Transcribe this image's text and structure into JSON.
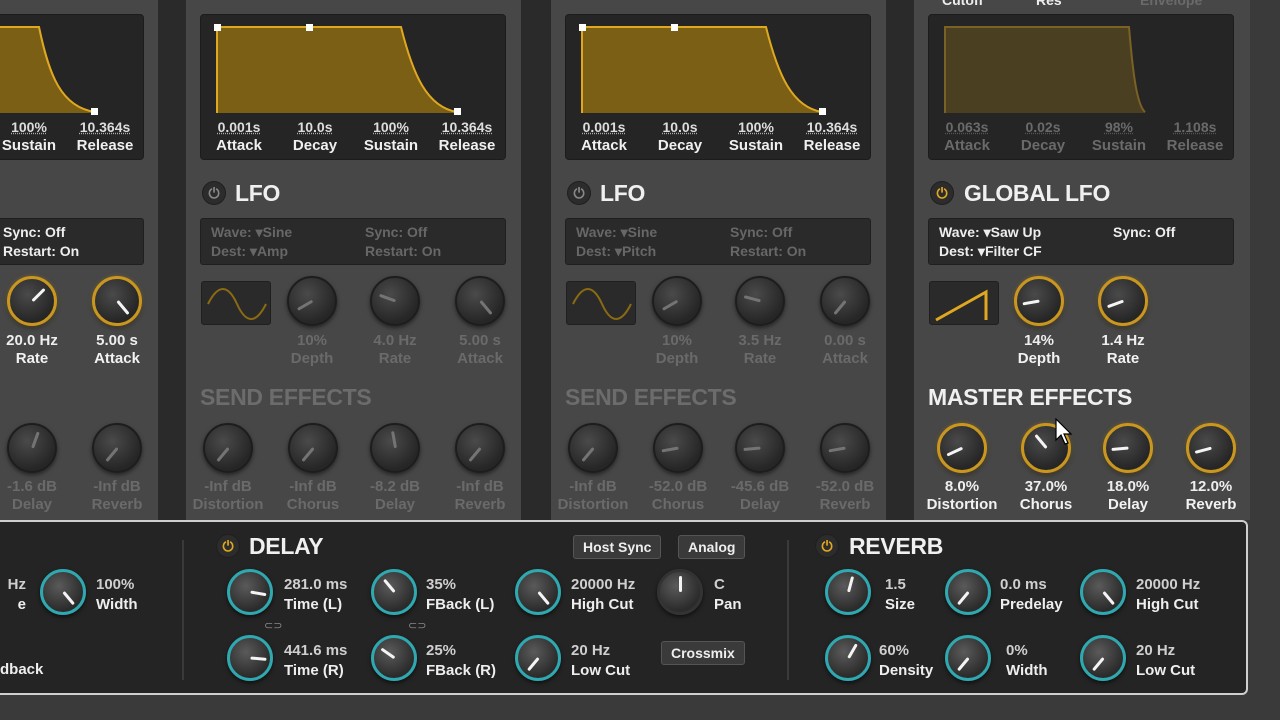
{
  "colors": {
    "accent_gold": "#d9a21f",
    "accent_teal": "#2fa8b0",
    "dim_text": "#6a6a6a"
  },
  "col0": {
    "env": [
      {
        "value": "100%",
        "label": "Sustain"
      },
      {
        "value": "10.364s",
        "label": "Release"
      }
    ],
    "lfo": {
      "sync_label": "Sync:",
      "sync_value": "Off",
      "restart_label": "Restart:",
      "restart_value": "On"
    },
    "knobs": [
      {
        "value": "20.0 Hz",
        "label": "Rate"
      },
      {
        "value": "5.00 s",
        "label": "Attack"
      }
    ],
    "send": [
      {
        "value": "-1.6 dB",
        "label": "Delay"
      },
      {
        "value": "-Inf dB",
        "label": "Reverb"
      }
    ]
  },
  "col1": {
    "env": [
      {
        "value": "0.001s",
        "label": "Attack"
      },
      {
        "value": "10.0s",
        "label": "Decay"
      },
      {
        "value": "100%",
        "label": "Sustain"
      },
      {
        "value": "10.364s",
        "label": "Release"
      }
    ],
    "lfo_title": "LFO",
    "lfo": {
      "wave_label": "Wave:",
      "wave_value": "Sine",
      "dest_label": "Dest:",
      "dest_value": "Amp",
      "sync_label": "Sync:",
      "sync_value": "Off",
      "restart_label": "Restart:",
      "restart_value": "On"
    },
    "knobs": [
      {
        "value": "10%",
        "label": "Depth"
      },
      {
        "value": "4.0 Hz",
        "label": "Rate"
      },
      {
        "value": "5.00 s",
        "label": "Attack"
      }
    ],
    "send_title": "SEND EFFECTS",
    "send": [
      {
        "value": "-Inf dB",
        "label": "Distortion"
      },
      {
        "value": "-Inf dB",
        "label": "Chorus"
      },
      {
        "value": "-8.2 dB",
        "label": "Delay"
      },
      {
        "value": "-Inf dB",
        "label": "Reverb"
      }
    ]
  },
  "col2": {
    "env": [
      {
        "value": "0.001s",
        "label": "Attack"
      },
      {
        "value": "10.0s",
        "label": "Decay"
      },
      {
        "value": "100%",
        "label": "Sustain"
      },
      {
        "value": "10.364s",
        "label": "Release"
      }
    ],
    "lfo_title": "LFO",
    "lfo": {
      "wave_label": "Wave:",
      "wave_value": "Sine",
      "dest_label": "Dest:",
      "dest_value": "Pitch",
      "sync_label": "Sync:",
      "sync_value": "Off",
      "restart_label": "Restart:",
      "restart_value": "On"
    },
    "knobs": [
      {
        "value": "10%",
        "label": "Depth"
      },
      {
        "value": "3.5 Hz",
        "label": "Rate"
      },
      {
        "value": "0.00 s",
        "label": "Attack"
      }
    ],
    "send_title": "SEND EFFECTS",
    "send": [
      {
        "value": "-Inf dB",
        "label": "Distortion"
      },
      {
        "value": "-52.0 dB",
        "label": "Chorus"
      },
      {
        "value": "-45.6 dB",
        "label": "Delay"
      },
      {
        "value": "-52.0 dB",
        "label": "Reverb"
      }
    ]
  },
  "col3": {
    "top_labels": [
      "Cutoff",
      "Res",
      "Envelope"
    ],
    "env": [
      {
        "value": "0.063s",
        "label": "Attack"
      },
      {
        "value": "0.02s",
        "label": "Decay"
      },
      {
        "value": "98%",
        "label": "Sustain"
      },
      {
        "value": "1.108s",
        "label": "Release"
      }
    ],
    "lfo_title": "GLOBAL LFO",
    "lfo": {
      "wave_label": "Wave:",
      "wave_value": "Saw Up",
      "dest_label": "Dest:",
      "dest_value": "Filter CF",
      "sync_label": "Sync:",
      "sync_value": "Off"
    },
    "knobs": [
      {
        "value": "14%",
        "label": "Depth"
      },
      {
        "value": "1.4 Hz",
        "label": "Rate"
      }
    ],
    "master_title": "MASTER EFFECTS",
    "master": [
      {
        "value": "8.0%",
        "label": "Distortion"
      },
      {
        "value": "37.0%",
        "label": "Chorus"
      },
      {
        "value": "18.0%",
        "label": "Delay"
      },
      {
        "value": "12.0%",
        "label": "Reverb"
      }
    ]
  },
  "bottom": {
    "chorus_partial": {
      "rate_value": "Hz",
      "rate_label": "e",
      "width_value": "100%",
      "width_label": "Width",
      "feedback_label": "dback"
    },
    "delay": {
      "title": "DELAY",
      "host_sync": "Host Sync",
      "analog": "Analog",
      "crossmix": "Crossmix",
      "time_l": {
        "value": "281.0 ms",
        "label": "Time (L)"
      },
      "time_r": {
        "value": "441.6 ms",
        "label": "Time (R)"
      },
      "fback_l": {
        "value": "35%",
        "label": "FBack (L)"
      },
      "fback_r": {
        "value": "25%",
        "label": "FBack (R)"
      },
      "high_cut": {
        "value": "20000 Hz",
        "label": "High Cut"
      },
      "low_cut": {
        "value": "20 Hz",
        "label": "Low Cut"
      },
      "pan": {
        "value": "C",
        "label": "Pan"
      }
    },
    "reverb": {
      "title": "REVERB",
      "size": {
        "value": "1.5",
        "label": "Size"
      },
      "predelay": {
        "value": "0.0 ms",
        "label": "Predelay"
      },
      "high_cut": {
        "value": "20000 Hz",
        "label": "High Cut"
      },
      "density": {
        "value": "60%",
        "label": "Density"
      },
      "width": {
        "value": "0%",
        "label": "Width"
      },
      "low_cut": {
        "value": "20 Hz",
        "label": "Low Cut"
      }
    }
  }
}
